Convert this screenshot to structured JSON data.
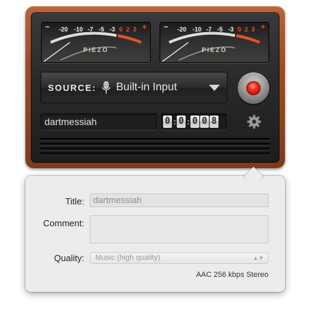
{
  "meters": [
    {
      "brand": "PIEZO",
      "minus": "−",
      "plus": "+",
      "scale": [
        "-20",
        "-10",
        "-7",
        "-5",
        "-3",
        "0",
        "2",
        "3"
      ],
      "level": 0.0
    },
    {
      "brand": "PIEZO",
      "minus": "−",
      "plus": "+",
      "scale": [
        "-20",
        "-10",
        "-7",
        "-5",
        "-3",
        "0",
        "2",
        "3"
      ],
      "level": 0.0
    }
  ],
  "source": {
    "label": "SOURCE:",
    "value": "Built-in Input",
    "icon": "microphone-icon"
  },
  "record": {
    "icon": "record-led",
    "color": "#f02b1c"
  },
  "recording_name": "dartmessiah",
  "counter": {
    "digits": [
      "0",
      "0",
      "0",
      "0",
      "8"
    ]
  },
  "settings": {
    "icon": "gear-icon"
  },
  "details": {
    "title_label": "Title:",
    "title_value": "dartmessiah",
    "comment_label": "Comment:",
    "comment_value": "",
    "quality_label": "Quality:",
    "quality_value": "Music (high quality)",
    "format_text": "AAC 256 kbps Stereo"
  },
  "colors": {
    "wood": "#9a4e28",
    "accent_red": "#e5542a",
    "panel": "#2a2a2c",
    "popover": "#ececec"
  }
}
